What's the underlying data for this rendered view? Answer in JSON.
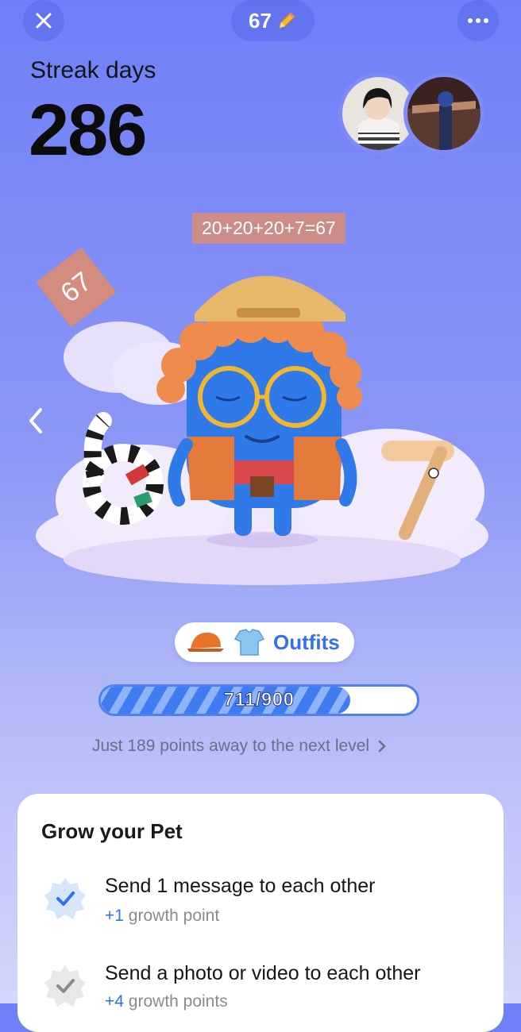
{
  "header": {
    "close_icon": "close-icon",
    "streak_count": "67",
    "streak_emoji_icon": "pencil-icon",
    "more_icon": "more-icon"
  },
  "streak": {
    "label": "Streak days",
    "value": "286"
  },
  "annotations": {
    "formula": "20+20+20+7=67",
    "tilted_tag": "67"
  },
  "pet": {
    "outfits_label": "Outfits",
    "progress_text": "711/900",
    "progress_fraction": 0.79,
    "next_level_text": "Just 189 points away to the next level"
  },
  "card": {
    "title": "Grow your Pet",
    "tasks": [
      {
        "title": "Send 1 message to each other",
        "points": "+1",
        "unit": "growth point",
        "done": true
      },
      {
        "title": "Send a photo or video to each other",
        "points": "+4",
        "unit": "growth points",
        "done": false
      }
    ]
  },
  "colors": {
    "accent": "#3170f0",
    "tag": "#d78c78"
  }
}
